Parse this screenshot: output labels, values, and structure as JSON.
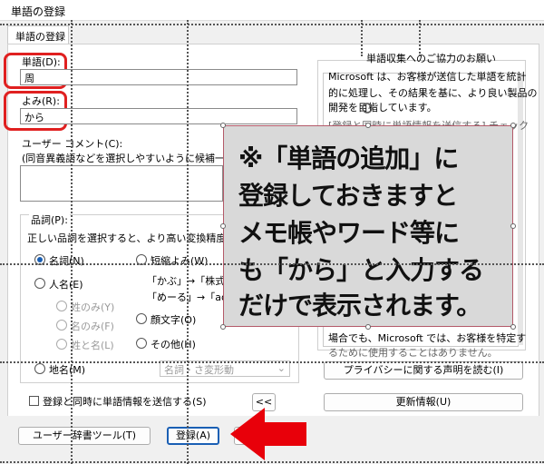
{
  "window": {
    "title": "単語の登録"
  },
  "tab": {
    "label": "単語の登録"
  },
  "word": {
    "label": "単語(D):",
    "value": "周"
  },
  "yomi": {
    "label": "よみ(R):",
    "value": "から"
  },
  "comment": {
    "label": "ユーザー コメント(C):",
    "hint": "(同音異義語などを選択しやすいように候補一覧に"
  },
  "pos": {
    "group_label": "品詞(P):",
    "hint": "正しい品詞を選択すると、より高い変換精度を得",
    "noun": "名詞(N)",
    "person": "人名(E)",
    "sei_mei": "姓のみ(Y)",
    "mei_only": "名のみ(F)",
    "sei_to_mei": "姓と名(L)",
    "place": "地名(M)",
    "tanshuku": "短縮よみ(W)",
    "tanshuku_ex1": "「かぶ」→「株式会社",
    "tanshuku_ex2": "「めーる」→「aoki@e",
    "kaomoji": "顔文字(O)",
    "other": "その他(H)",
    "place_select": "名詞・さ変形動"
  },
  "send_check": {
    "label": "登録と同時に単語情報を送信する(S)"
  },
  "collapse_button": "<<",
  "request": {
    "title": "単語収集へのご協力のお願い",
    "text1": "Microsoft は、お客様が送信した単語を統計",
    "text2": "的に処理し、その結果を基に、より良い製品の",
    "text3": "開発を目指しています。",
    "text4": "[登録と同時に単語情報を送信する] チェック",
    "text5": "場合でも、Microsoft では、お客様を特定す",
    "text6": "るために使用することはありません。",
    "privacy_button": "プライバシーに関する声明を読む(I)",
    "update_button": "更新情報(U)"
  },
  "bottom": {
    "user_dict_tool": "ユーザー辞書ツール(T)",
    "register": "登録(A)"
  },
  "overlay": {
    "line1": "※「単語の追加」に",
    "line2": "登録しておきますと",
    "line3": "メモ帳やワード等に",
    "line4": "も「から」と入力する",
    "line5": "だけで表示されます。"
  },
  "colors": {
    "highlight_red": "#e02020",
    "arrow_red": "#e8000a",
    "accent": "#1a5fb4"
  }
}
